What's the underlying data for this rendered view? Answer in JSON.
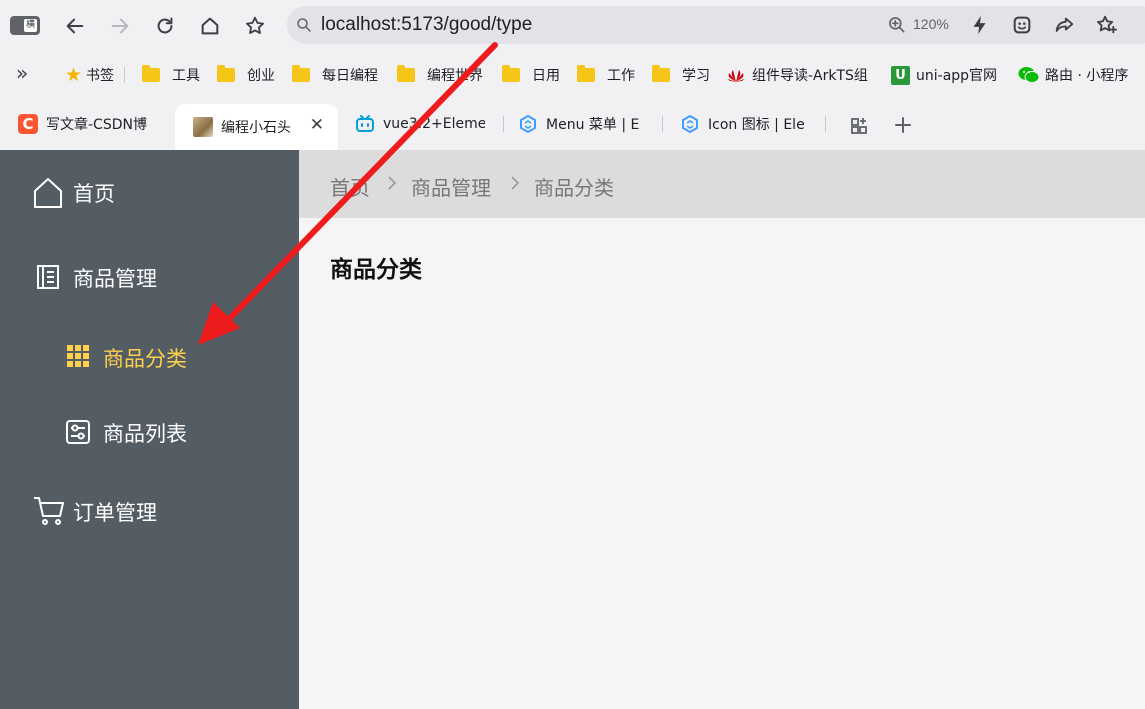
{
  "browser": {
    "window_icon_char": "横",
    "url": "localhost:5173/good/type",
    "zoom": "120%"
  },
  "bookmarks": {
    "overflow": "»",
    "items": [
      {
        "label": "书签",
        "icon": "star-icon"
      },
      {
        "label": "工具",
        "icon": "folder-icon"
      },
      {
        "label": "创业",
        "icon": "folder-icon"
      },
      {
        "label": "每日编程",
        "icon": "folder-icon"
      },
      {
        "label": "编程世界",
        "icon": "folder-icon"
      },
      {
        "label": "日用",
        "icon": "folder-icon"
      },
      {
        "label": "工作",
        "icon": "folder-icon"
      },
      {
        "label": "学习",
        "icon": "folder-icon"
      },
      {
        "label": "组件导读-ArkTS组",
        "icon": "huawei-icon"
      },
      {
        "label": "uni-app官网",
        "icon": "uniapp-icon"
      },
      {
        "label": "路由 · 小程序",
        "icon": "wechat-icon"
      }
    ]
  },
  "tabs": [
    {
      "label": "写文章-CSDN博",
      "icon": "csdn-icon",
      "color": "#fc5531"
    },
    {
      "label": "编程小石头",
      "icon": "avatar-icon",
      "active": true
    },
    {
      "label": "vue3.2+Eleme",
      "icon": "bilibili-icon",
      "color": "#00a1d6"
    },
    {
      "label": "Menu 菜单 | E",
      "icon": "element-icon",
      "color": "#409eff"
    },
    {
      "label": "Icon 图标 | Ele",
      "icon": "element-icon",
      "color": "#409eff"
    }
  ],
  "sidebar": {
    "bg": "#545c64",
    "active_color": "#ffd04b",
    "items": [
      {
        "label": "首页",
        "icon": "house-icon"
      },
      {
        "label": "商品管理",
        "icon": "notebook-icon"
      },
      {
        "label": "商品分类",
        "icon": "grid-icon",
        "active": true
      },
      {
        "label": "商品列表",
        "icon": "list-panel-icon"
      },
      {
        "label": "订单管理",
        "icon": "cart-icon"
      }
    ]
  },
  "breadcrumb": [
    "首页",
    "商品管理",
    "商品分类"
  ],
  "main": {
    "title": "商品分类"
  },
  "annotation": {
    "arrow_color": "#ee1c1c"
  }
}
